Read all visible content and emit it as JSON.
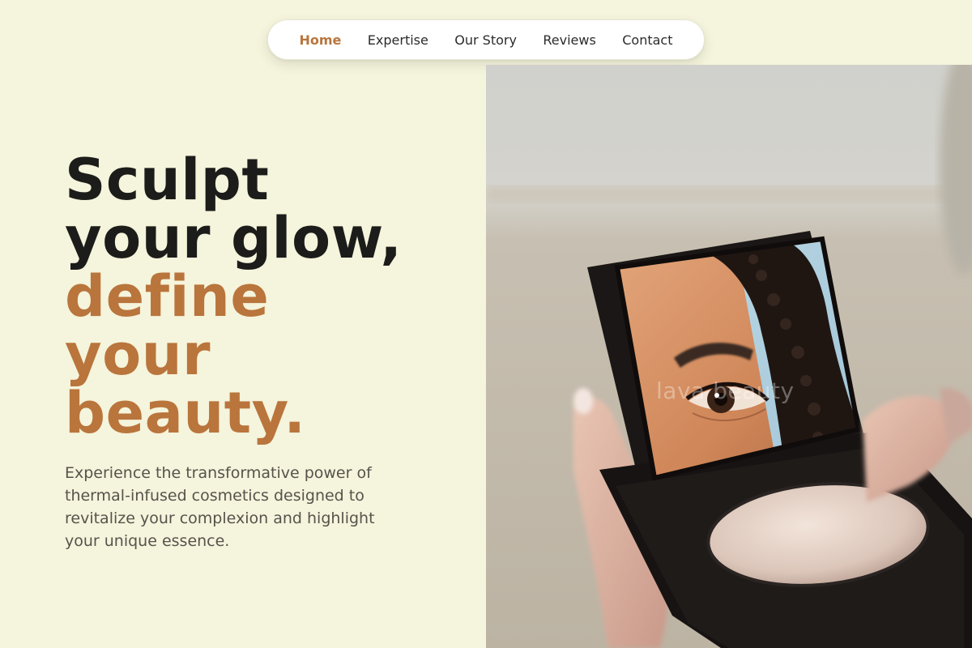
{
  "nav": {
    "items": [
      {
        "label": "Home",
        "active": true
      },
      {
        "label": "Expertise",
        "active": false
      },
      {
        "label": "Our Story",
        "active": false
      },
      {
        "label": "Reviews",
        "active": false
      },
      {
        "label": "Contact",
        "active": false
      }
    ]
  },
  "hero": {
    "headline_line1": "Sculpt",
    "headline_line2": "your glow,",
    "headline_line3": "define",
    "headline_line4": "your",
    "headline_line5": "beauty.",
    "description": "Experience the transformative power of thermal-infused cosmetics designed to revitalize your complexion and highlight your unique essence."
  },
  "image": {
    "watermark": "lava beauty",
    "subject": "hand holding compact mirror reflecting an eye"
  },
  "colors": {
    "background": "#f5f4dc",
    "accent": "#b9753c",
    "headline_dark": "#1c1c1a",
    "body_text": "#56534c"
  }
}
